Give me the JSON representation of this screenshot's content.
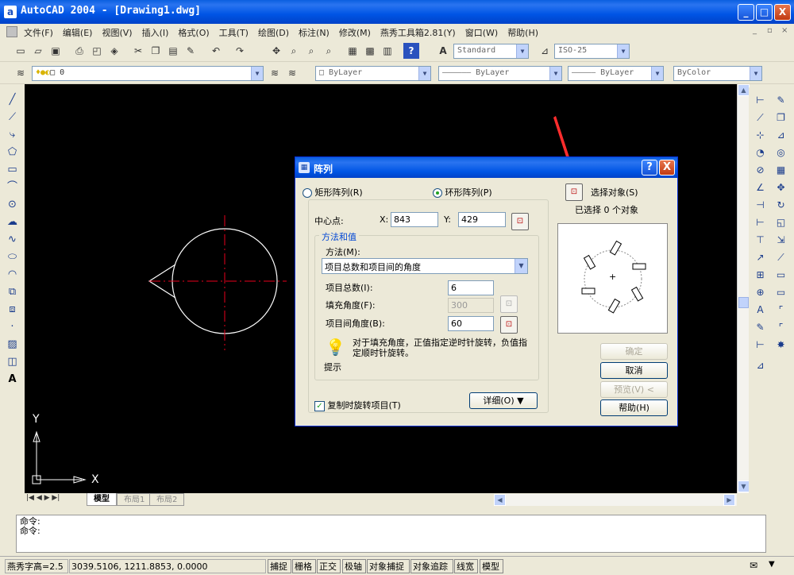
{
  "window": {
    "title": "AutoCAD 2004 - [Drawing1.dwg]",
    "icon": "autocad-app-icon",
    "buttons": {
      "minimize": "_",
      "maximize": "□",
      "close": "X"
    }
  },
  "menubar": {
    "items": [
      "文件(F)",
      "编辑(E)",
      "视图(V)",
      "插入(I)",
      "格式(O)",
      "工具(T)",
      "绘图(D)",
      "标注(N)",
      "修改(M)",
      "燕秀工具箱2.81(Y)",
      "窗口(W)",
      "帮助(H)"
    ]
  },
  "toolbar1": {
    "text_style": "Standard",
    "dim_style": "ISO-25"
  },
  "toolbar2": {
    "layer": "0",
    "color": "ByLayer",
    "linetype": "ByLayer",
    "lineweight": "ByLayer",
    "plotstyle": "ByColor"
  },
  "canvas": {
    "ucs_y": "Y",
    "ucs_x": "X"
  },
  "layout_tabs": [
    "模型",
    "布局1",
    "布局2"
  ],
  "command": {
    "lines": [
      "命令:",
      "命令:"
    ]
  },
  "status": {
    "font_height": "燕秀字高=2.5",
    "coords": "3039.5106,  1211.8853,  0.0000",
    "toggles": [
      "捕捉",
      "栅格",
      "正交",
      "极轴",
      "对象捕捉",
      "对象追踪",
      "线宽",
      "模型"
    ]
  },
  "dialog": {
    "title": "阵列",
    "help_button": "?",
    "close_button": "X",
    "radio_rect": "矩形阵列(R)",
    "radio_polar": "环形阵列(P)",
    "select_objects": "选择对象(S)",
    "selected_count": "已选择 0 个对象",
    "center_label": "中心点:",
    "x_label": "X:",
    "x_value": "843",
    "y_label": "Y:",
    "y_value": "429",
    "group_label": "方法和值",
    "method_label": "方法(M):",
    "method_value": "项目总数和项目间的角度",
    "total_label": "项目总数(I):",
    "total_value": "6",
    "fill_label": "填充角度(F):",
    "fill_value": "300",
    "between_label": "项目间角度(B):",
    "between_value": "60",
    "tip_text": "对于填充角度，正值指定逆时针旋转，负值指定顺时针旋转。",
    "tip_label": "提示",
    "rotate_label": "复制时旋转项目(T)",
    "detail_button": "详细(O)",
    "detail_arrow": "▼",
    "preview_center": "+",
    "ok": "确定",
    "cancel": "取消",
    "preview": "预览(V)",
    "preview_arrow": "<",
    "help": "帮助(H)"
  },
  "colors": {
    "accent": "#0055e5",
    "crosshair": "#e8001c",
    "arrow": "#ff2d2d"
  }
}
